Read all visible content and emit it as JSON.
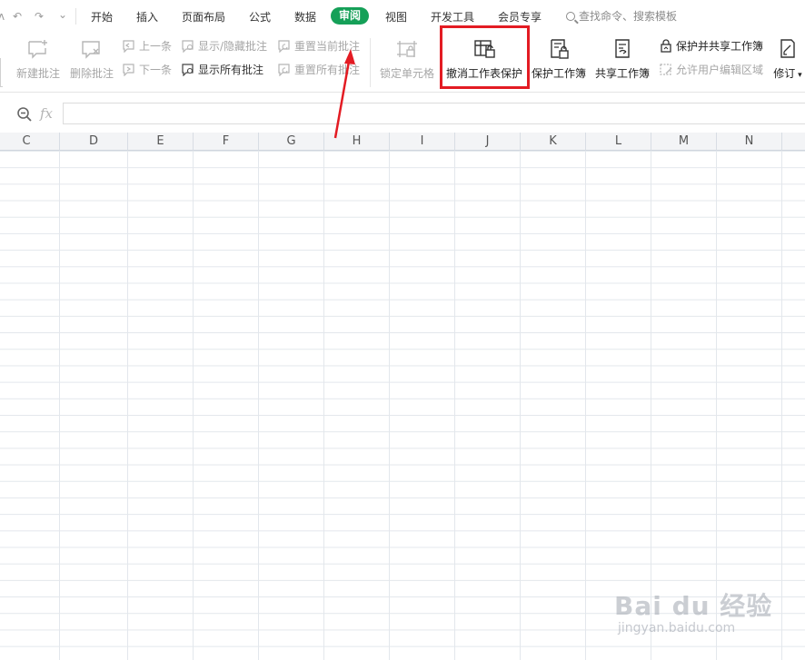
{
  "quick_access": {
    "undo_symbol": "↶",
    "redo_symbol": "↷",
    "more_symbol": "⌄"
  },
  "menu": {
    "tabs": [
      "开始",
      "插入",
      "页面布局",
      "公式",
      "数据",
      "审阅",
      "视图",
      "开发工具",
      "会员专享"
    ],
    "active_tab": "审阅",
    "search_placeholder": "查找命令、搜索模板"
  },
  "ribbon": {
    "new_comment": "新建批注",
    "delete_comment": "删除批注",
    "previous": "上一条",
    "next": "下一条",
    "show_hide_comments": "显示/隐藏批注",
    "show_all_comments": "显示所有批注",
    "reset_current_comment": "重置当前批注",
    "reset_all_comments": "重置所有批注",
    "lock_cell": "锁定单元格",
    "unprotect_sheet": "撤消工作表保护",
    "protect_workbook": "保护工作簿",
    "share_workbook": "共享工作簿",
    "protect_and_share": "保护并共享工作簿",
    "allow_edit_ranges": "允许用户编辑区域",
    "track_changes": "修订"
  },
  "formula_bar": {
    "fx_label": "fx",
    "value": ""
  },
  "columns": [
    "C",
    "D",
    "E",
    "F",
    "G",
    "H",
    "I",
    "J",
    "K",
    "L",
    "M",
    "N"
  ],
  "watermark": {
    "logo": "Bai du 经验",
    "url": "jingyan.baidu.com"
  },
  "colors": {
    "accent": "#15a058",
    "highlight": "#e31b23",
    "arrow": "#e31b23"
  }
}
